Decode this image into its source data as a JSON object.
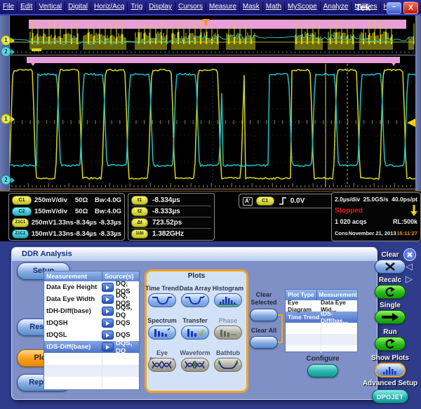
{
  "menu": {
    "items": [
      "File",
      "Edit",
      "Vertical",
      "Digital",
      "Horiz/Acq",
      "Trig",
      "Display",
      "Cursors",
      "Measure",
      "Mask",
      "Math",
      "MyScope",
      "Analyze",
      "Utilities",
      "Help"
    ],
    "brand": "Tek"
  },
  "waveform": {
    "overview_ch1_marker": "1",
    "overview_ch2_marker": "2",
    "main_ch1_marker": "1",
    "main_ch2_marker": "2",
    "colors": {
      "ch1": "#d8d818",
      "ch2": "#1cc3cc",
      "zoom_band": "#e79ed9",
      "trigger_marker": "#ff9000"
    }
  },
  "readouts": {
    "channels": [
      {
        "badge": "C1",
        "c1": "250mV/div",
        "c2": "50Ω",
        "c3": "Bw:4.0G"
      },
      {
        "badge": "C2",
        "c1": "150mV/div",
        "c2": "50Ω",
        "c3": "Bw:4.0G"
      },
      {
        "badge": "Z1C1",
        "c1": "250mV",
        "c2": "1.33ns",
        "c3": "-8.34µs",
        "c4": "-8.33µs"
      },
      {
        "badge": "Z1C2",
        "c1": "150mV",
        "c2": "1.33ns",
        "c3": "-8.34µs",
        "c4": "-8.33µs"
      }
    ],
    "cursors": [
      {
        "badge": "t1",
        "value": "-8.334µs"
      },
      {
        "badge": "t2",
        "value": "-8.333µs"
      },
      {
        "badge": "Δt",
        "value": "723.52ps"
      },
      {
        "badge": "1/Δt",
        "value": "1.382GHz"
      }
    ],
    "trigger": {
      "label": "A'",
      "source": "C1",
      "level": "0.0V"
    },
    "acq": {
      "timebase": "2.0µs/div",
      "rate": "25.0GS/s",
      "res": "40.0ps/pt",
      "status": "Stopped",
      "status_color": "#e81818",
      "acqs": "1 020 acqs",
      "rl": "RL:500k",
      "cons": "Cons",
      "date": "November 21, 2013",
      "time": "15:11:27",
      "time_color": "#ff9000"
    }
  },
  "ddr": {
    "title": "DDR Analysis",
    "nav": [
      {
        "label": "Setup",
        "active": false
      },
      {
        "label": "Results",
        "active": false
      },
      {
        "label": "Plots",
        "active": true
      },
      {
        "label": "Reports",
        "active": false
      }
    ],
    "meas_table": {
      "headers": [
        "Measurement",
        "Source(s)"
      ],
      "rows": [
        {
          "measurement": "Data Eye Height",
          "sources": "DQ, DQS",
          "selected": false
        },
        {
          "measurement": "Data Eye Width",
          "sources": "DQ, DQS",
          "selected": false
        },
        {
          "measurement": "tDH-Diff(base)",
          "sources": "DQS, DQ",
          "selected": false
        },
        {
          "measurement": "tDQSH",
          "sources": "DQS",
          "selected": false
        },
        {
          "measurement": "tDQSL",
          "sources": "DQS",
          "selected": false
        },
        {
          "measurement": "tDS-Diff(base)",
          "sources": "DQS, DQ",
          "selected": true
        }
      ]
    },
    "plots": {
      "title": "Plots",
      "buttons": [
        {
          "label": "Time Trend",
          "icon": "time-trend-icon",
          "state": "enabled"
        },
        {
          "label": "Data Array",
          "icon": "data-array-icon",
          "state": "enabled"
        },
        {
          "label": "Histogram",
          "icon": "histogram-icon",
          "state": "enabled"
        },
        {
          "label": "Spectrum",
          "icon": "spectrum-icon",
          "state": "enabled"
        },
        {
          "label": "Transfer",
          "icon": "transfer-icon",
          "state": "enabled"
        },
        {
          "label": "Phase Noise",
          "icon": "phase-noise-icon",
          "state": "disabled"
        },
        {
          "label": "Eye Diagram",
          "icon": "eye-diagram-icon",
          "state": "enabled"
        },
        {
          "label": "Waveform",
          "icon": "waveform-icon",
          "state": "enabled"
        },
        {
          "label": "Bathtub",
          "icon": "bathtub-icon",
          "state": "enabled"
        }
      ]
    },
    "clear_selected": "Clear Selected",
    "clear_all": "Clear All",
    "plot_table": {
      "headers": [
        "Plot Type",
        "Measurement"
      ],
      "rows": [
        {
          "plot_type": "Eye Diagram",
          "measurement": "Data Eye Wid...",
          "selected": false
        },
        {
          "plot_type": "Time Trend",
          "measurement": "tDS-Diff(bas...",
          "selected": true
        }
      ]
    },
    "configure": "Configure"
  },
  "controls": {
    "clear": "Clear",
    "recalc": "Recalc",
    "single": "Single",
    "run": "Run",
    "show_plots": "Show Plots",
    "advanced_setup": "Advanced Setup",
    "dpojet": "DPOJET"
  }
}
